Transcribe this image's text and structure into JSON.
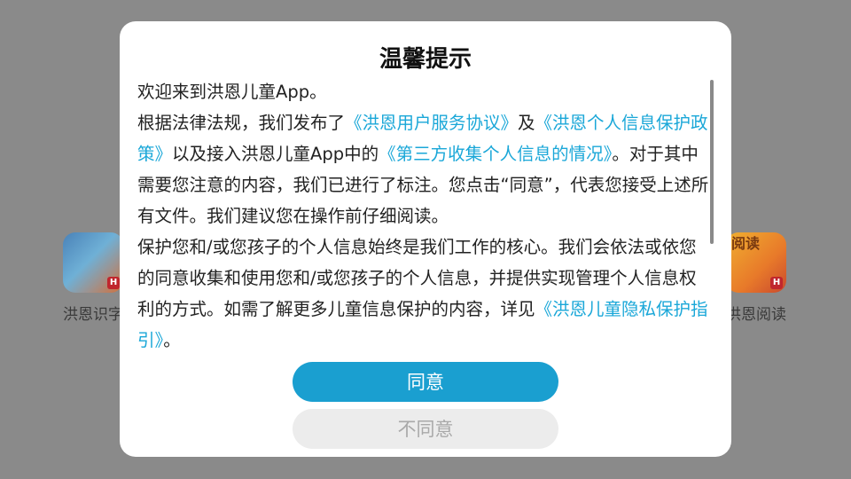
{
  "background_apps": [
    {
      "label": "洪恩识字",
      "icon": "dragon-mascot-icon"
    },
    {
      "label": "洪恩阅读",
      "icon": "squirrel-mascot-icon",
      "icon_text": "阅读"
    }
  ],
  "badge_letter": "H",
  "dialog": {
    "title": "温馨提示",
    "p1": "欢迎来到洪恩儿童App。",
    "p2_a": "根据法律法规，我们发布了",
    "p2_link1": "《洪恩用户服务协议》",
    "p2_b": "及",
    "p2_link2": "《洪恩个人信息保护政策》",
    "p2_c": "以及接入洪恩儿童App中的",
    "p2_link3": "《第三方收集个人信息的情况》",
    "p2_d": "。对于其中需要您注意的内容，我们已进行了标注。您点击“同意”，代表您接受上述所有文件。我们建议您在操作前仔细阅读。",
    "p3_a": "保护您和/或您孩子的个人信息始终是我们工作的核心。我们会依法或依您的同意收集和使用您和/或您孩子的个人信息，并提供实现管理个人信息权利的方式。如需了解更多儿童信息保护的内容，详见",
    "p3_link": "《洪恩儿童隐私保护指引》",
    "p3_b": "。",
    "agree_label": "同意",
    "disagree_label": "不同意"
  },
  "colors": {
    "link": "#1aa7d8",
    "primary_button": "#1a9fd0",
    "secondary_button": "#ececec"
  }
}
